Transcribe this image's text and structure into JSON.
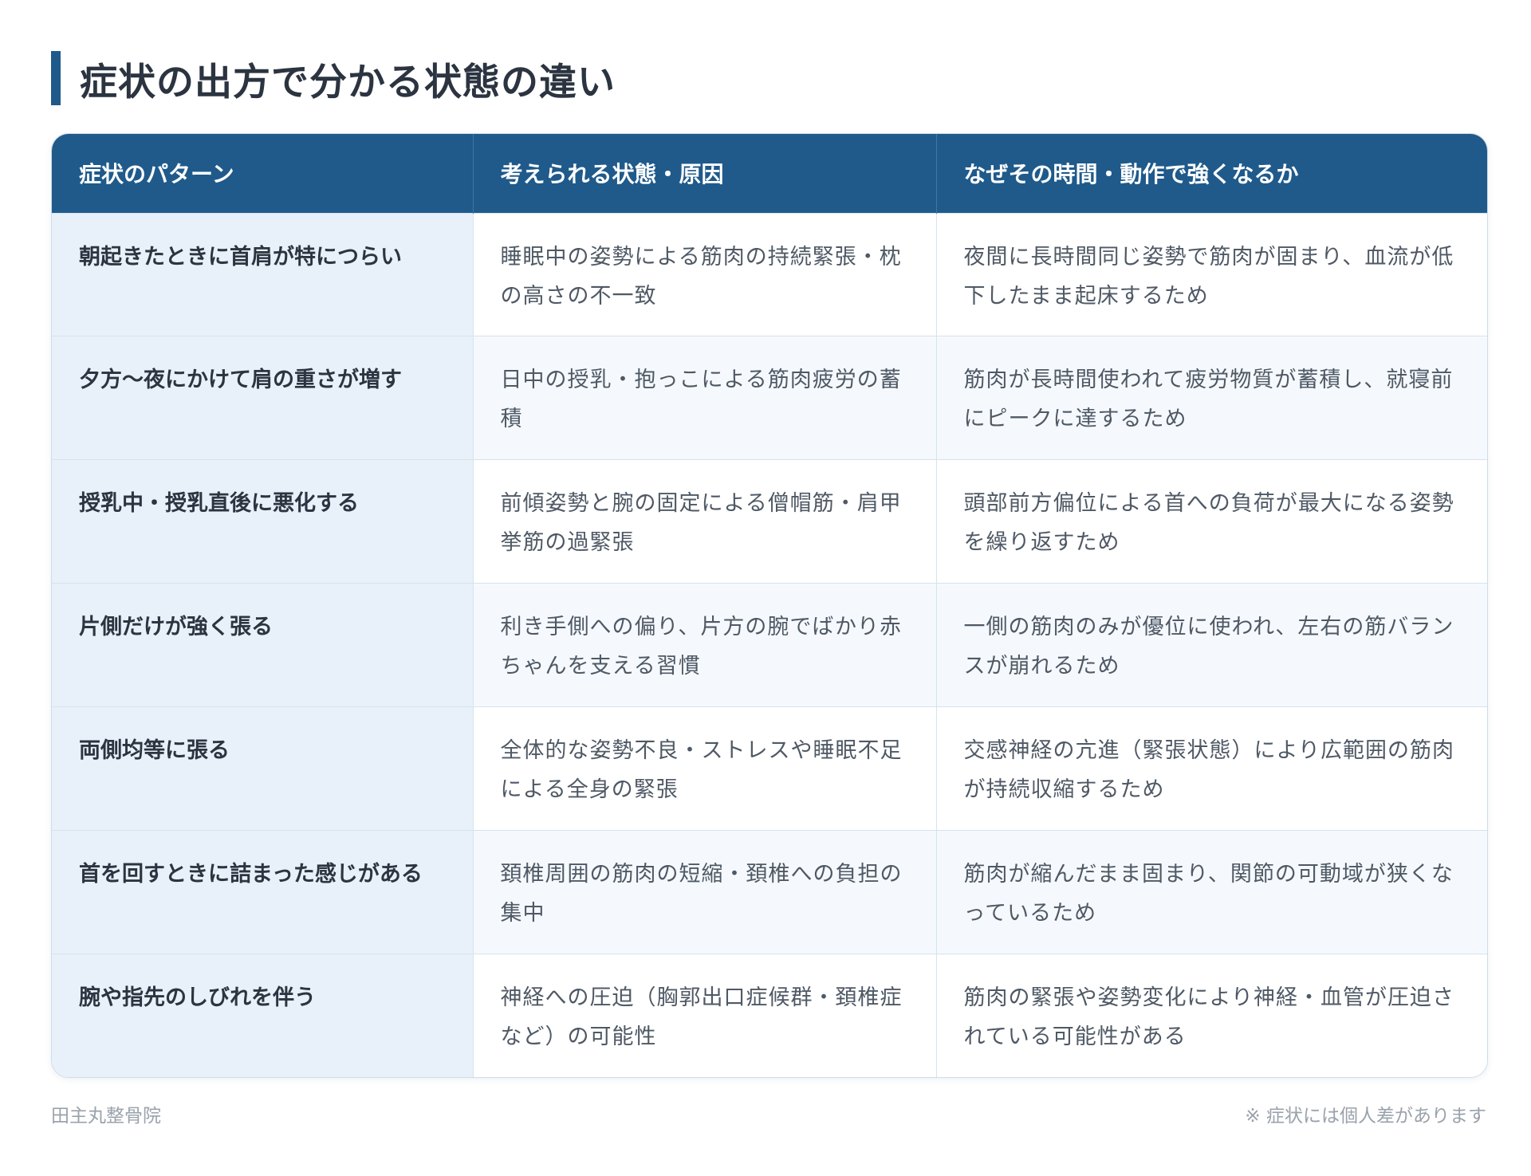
{
  "title": "症状の出方で分かる状態の違い",
  "table": {
    "headers": [
      "症状のパターン",
      "考えられる状態・原因",
      "なぜその時間・動作で強くなるか"
    ],
    "rows": [
      {
        "pattern": "朝起きたときに首肩が特につらい",
        "cause": "睡眠中の姿勢による筋肉の持続緊張・枕の高さの不一致",
        "reason": "夜間に長時間同じ姿勢で筋肉が固まり、血流が低下したまま起床するため"
      },
      {
        "pattern": "夕方〜夜にかけて肩の重さが増す",
        "cause": "日中の授乳・抱っこによる筋肉疲労の蓄積",
        "reason": "筋肉が長時間使われて疲労物質が蓄積し、就寝前にピークに達するため"
      },
      {
        "pattern": "授乳中・授乳直後に悪化する",
        "cause": "前傾姿勢と腕の固定による僧帽筋・肩甲挙筋の過緊張",
        "reason": "頭部前方偏位による首への負荷が最大になる姿勢を繰り返すため"
      },
      {
        "pattern": "片側だけが強く張る",
        "cause": "利き手側への偏り、片方の腕でばかり赤ちゃんを支える習慣",
        "reason": "一側の筋肉のみが優位に使われ、左右の筋バランスが崩れるため"
      },
      {
        "pattern": "両側均等に張る",
        "cause": "全体的な姿勢不良・ストレスや睡眠不足による全身の緊張",
        "reason": "交感神経の亢進（緊張状態）により広範囲の筋肉が持続収縮するため"
      },
      {
        "pattern": "首を回すときに詰まった感じがある",
        "cause": "頚椎周囲の筋肉の短縮・頚椎への負担の集中",
        "reason": "筋肉が縮んだまま固まり、関節の可動域が狭くなっているため"
      },
      {
        "pattern": "腕や指先のしびれを伴う",
        "cause": "神経への圧迫（胸郭出口症候群・頚椎症など）の可能性",
        "reason": "筋肉の緊張や姿勢変化により神経・血管が圧迫されている可能性がある"
      }
    ]
  },
  "footer": {
    "clinic": "田主丸整骨院",
    "note": "※ 症状には個人差があります"
  },
  "colors": {
    "header_bg": "#1f5a8b",
    "pattern_bg": "#e8f1f9",
    "accent": "#1f5a8b"
  }
}
